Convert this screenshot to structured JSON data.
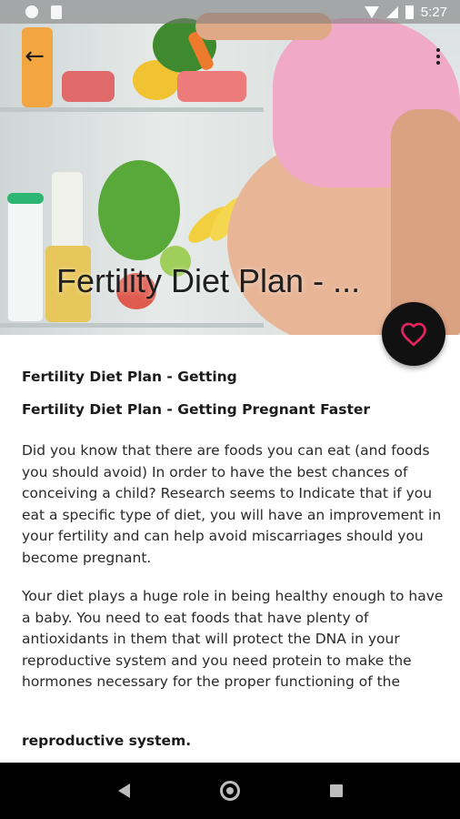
{
  "status_bar": {
    "time": "5:27"
  },
  "toolbar": {
    "back_icon": "arrow-left-icon",
    "menu_icon": "more-vert-icon"
  },
  "hero": {
    "title": "Fertility Diet Plan - ...",
    "favorite_icon": "heart-outline-icon",
    "favorite_color": "#e0245e"
  },
  "article": {
    "heading_short": "Fertility Diet Plan - Getting",
    "heading_full": "Fertility Diet Plan - Getting Pregnant Faster",
    "paragraph_1": "Did you know that there are foods you can eat (and foods you should avoid) In order to have the best chances of conceiving a child? Research seems to Indicate that if you eat a specific type of diet, you will have an improvement in your fertility and can help avoid miscarriages should you become pregnant.",
    "paragraph_2": "Your diet plays a huge role in being healthy enough to have a baby. You need to eat foods that have plenty of antioxidants in them that will protect the DNA in your reproductive system and you need protein to make the hormones necessary for the proper functioning of the",
    "subheading": "reproductive system."
  },
  "nav_bar": {
    "back_icon": "nav-back-icon",
    "home_icon": "nav-home-icon",
    "recents_icon": "nav-recents-icon"
  }
}
